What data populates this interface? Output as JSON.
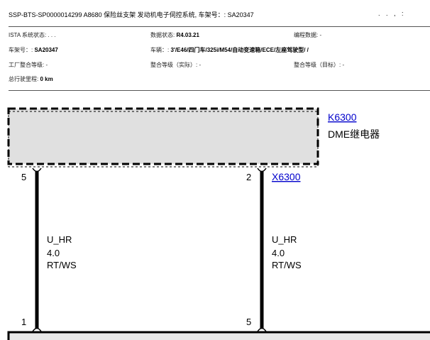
{
  "header": {
    "title": "SSP-BTS-SP0000014299 A8680 保险丝支架 发动机电子伺控系统, 车架号：: SA20347",
    "right_marks": ". . , :"
  },
  "info": {
    "ista_label": "ISTA 系统状态:",
    "ista_value": ". . .",
    "data_status_label": "数据状态:",
    "data_status_value": "R4.03.21",
    "prog_data_label": "编程数据: -",
    "vin_label": "车架号：:",
    "vin_value": "SA20347",
    "vehicle_label": "车辆：:",
    "vehicle_value": "3'/E46/四门车/325i/M54/自动变速箱/ECE/左座驾驶型/ /",
    "factory_level": "工厂整合等级: -",
    "actual_level": "整合等级（实际）: -",
    "target_level": "整合等级（目标）: -",
    "mileage_label": "总行驶里程:",
    "mileage_value": "0 km"
  },
  "diagram": {
    "component_id": "K6300",
    "component_name": "DME继电器",
    "connector_id": "X6300",
    "wires": [
      {
        "pin_top": "5",
        "pin_bottom": "1",
        "signal": "U_HR",
        "gauge": "4.0",
        "color_code": "RT/WS"
      },
      {
        "pin_top": "2",
        "pin_bottom": "5",
        "signal": "U_HR",
        "gauge": "4.0",
        "color_code": "RT/WS"
      }
    ],
    "colors": {
      "component_fill": "#e0e0e0",
      "wire": "#000000",
      "link": "#0000cc"
    }
  }
}
